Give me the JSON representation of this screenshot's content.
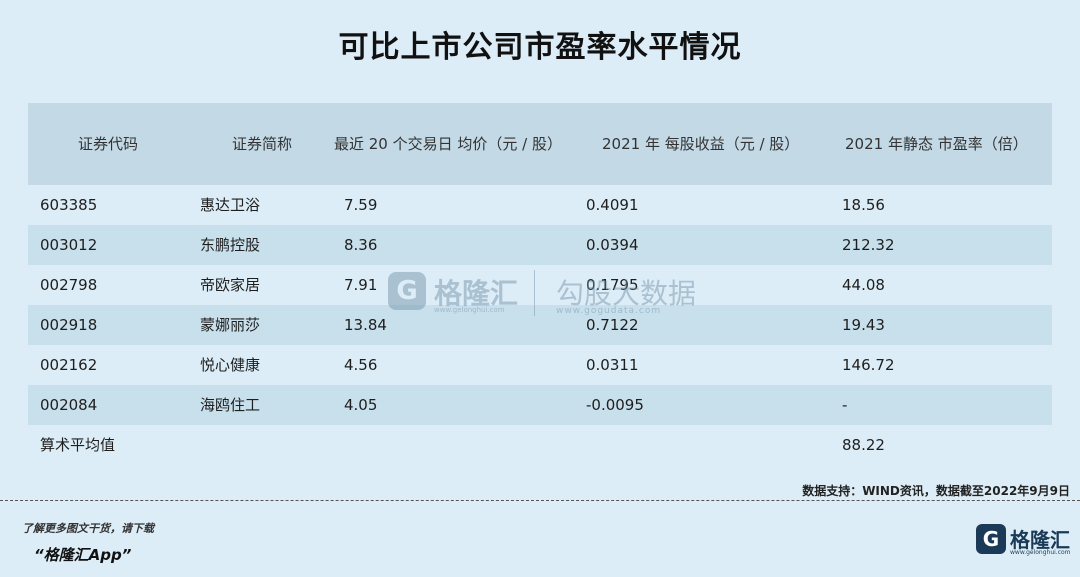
{
  "title": "可比上市公司市盈率水平情况",
  "table": {
    "headers": [
      "证券代码",
      "证券简称",
      "最近 20 个交易日 均价（元 / 股）",
      "2021 年 每股收益（元 / 股）",
      "2021 年静态 市盈率（倍）"
    ],
    "rows": [
      [
        "603385",
        "惠达卫浴",
        "7.59",
        "0.4091",
        "18.56"
      ],
      [
        "003012",
        "东鹏控股",
        "8.36",
        "0.0394",
        "212.32"
      ],
      [
        "002798",
        "帝欧家居",
        "7.91",
        "0.1795",
        "44.08"
      ],
      [
        "002918",
        "蒙娜丽莎",
        "13.84",
        "0.7122",
        "19.43"
      ],
      [
        "002162",
        "悦心健康",
        "4.56",
        "0.0311",
        "146.72"
      ],
      [
        "002084",
        "海鸥住工",
        "4.05",
        "-0.0095",
        "-"
      ]
    ],
    "average": {
      "label": "算术平均值",
      "value": "88.22"
    }
  },
  "watermark": {
    "logo_letter": "G",
    "brand": "格隆汇",
    "url": "www.gelonghui.com",
    "brand2": "勾股大数据",
    "url2": "www.gogudata.com"
  },
  "source": "数据支持：WIND资讯，数据截至2022年9月9日",
  "promo": {
    "line1": "了解更多图文干货，请下载",
    "line2": "“格隆汇App”"
  },
  "brand": {
    "logo_letter": "G",
    "name": "格隆汇",
    "url": "www.gelonghui.com"
  }
}
